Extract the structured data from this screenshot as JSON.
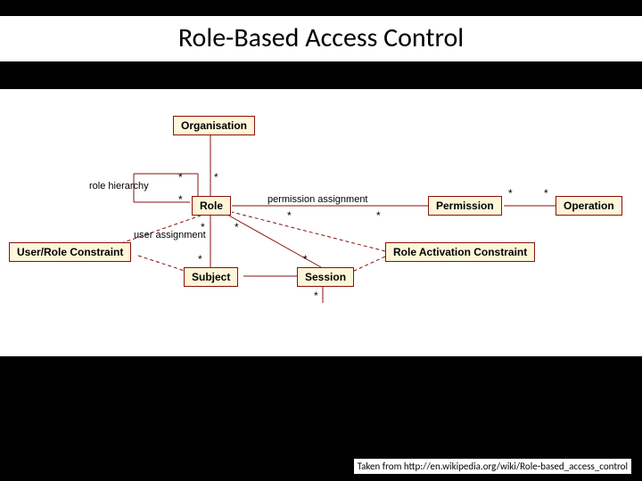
{
  "title": "Role-Based Access Control",
  "credit": "Taken from http://en.wikipedia.org/wiki/Role-based_access_control",
  "boxes": {
    "organisation": "Organisation",
    "role": "Role",
    "permission": "Permission",
    "operation": "Operation",
    "user_role_constraint": "User/Role Constraint",
    "role_activation_constraint": "Role Activation Constraint",
    "subject": "Subject",
    "session": "Session"
  },
  "labels": {
    "role_hierarchy": "role hierarchy",
    "permission_assignment": "permission assignment",
    "user_assignment": "user assignment"
  },
  "mult": "*"
}
